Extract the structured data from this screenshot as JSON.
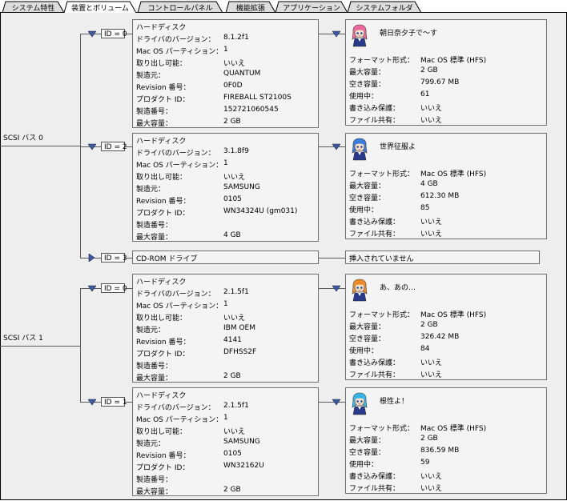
{
  "tabs": [
    {
      "label": "システム特性",
      "active": false
    },
    {
      "label": "装置とボリューム",
      "active": true
    },
    {
      "label": "コントロールパネル",
      "active": false
    },
    {
      "label": "機能拡張",
      "active": false
    },
    {
      "label": "アプリケーション",
      "active": false
    },
    {
      "label": "システムフォルダ",
      "active": false
    }
  ],
  "buses": [
    {
      "label": "SCSI バス 0",
      "devices": [
        {
          "id": "ID = 0",
          "expanded": true,
          "info": {
            "title": "ハードディスク",
            "rows": [
              {
                "k": "ドライバのバージョン：",
                "v": "8.1.2f1"
              },
              {
                "k": "Mac OS パーティション：",
                "v": "1"
              },
              {
                "k": "取り出し可能：",
                "v": "いいえ"
              },
              {
                "k": "製造元：",
                "v": "QUANTUM"
              },
              {
                "k": "Revision 番号：",
                "v": "0F0D"
              },
              {
                "k": "プロダクト ID：",
                "v": "FIREBALL ST2100S"
              },
              {
                "k": "製造番号：",
                "v": "152721060545"
              },
              {
                "k": "最大容量：",
                "v": "2 GB"
              }
            ]
          },
          "volume": {
            "name": "朝日奈夕子で～す",
            "avatar": "pink",
            "rows": [
              {
                "k": "フォーマット形式：",
                "v": "Mac OS 標準 (HFS)"
              },
              {
                "k": "最大容量：",
                "v": "2 GB"
              },
              {
                "k": "空き容量：",
                "v": "799.67 MB"
              },
              {
                "k": "使用中：",
                "v": "61"
              },
              {
                "k": "書き込み保護：",
                "v": "いいえ"
              },
              {
                "k": "ファイル共有：",
                "v": "いいえ"
              }
            ]
          }
        },
        {
          "id": "ID = 2",
          "expanded": true,
          "info": {
            "title": "ハードディスク",
            "rows": [
              {
                "k": "ドライバのバージョン：",
                "v": "3.1.8f9"
              },
              {
                "k": "Mac OS パーティション：",
                "v": "1"
              },
              {
                "k": "取り出し可能：",
                "v": "いいえ"
              },
              {
                "k": "製造元：",
                "v": "SAMSUNG"
              },
              {
                "k": "Revision 番号：",
                "v": "0105"
              },
              {
                "k": "プロダクト ID：",
                "v": "WN34324U (gm031)"
              },
              {
                "k": "製造番号：",
                "v": ""
              },
              {
                "k": "最大容量：",
                "v": "4 GB"
              }
            ]
          },
          "volume": {
            "name": "世界征服よ",
            "avatar": "blue",
            "rows": [
              {
                "k": "フォーマット形式：",
                "v": "Mac OS 標準 (HFS)"
              },
              {
                "k": "最大容量：",
                "v": "4 GB"
              },
              {
                "k": "空き容量：",
                "v": "612.30 MB"
              },
              {
                "k": "使用中：",
                "v": "85"
              },
              {
                "k": "書き込み保護：",
                "v": "いいえ"
              },
              {
                "k": "ファイル共有：",
                "v": "いいえ"
              }
            ]
          }
        },
        {
          "id": "ID = 3",
          "expanded": false,
          "info": {
            "title": "CD-ROM ドライブ",
            "rows": []
          },
          "volume": {
            "empty_text": "挿入されていません"
          }
        }
      ]
    },
    {
      "label": "SCSI バス 1",
      "devices": [
        {
          "id": "ID = 0",
          "expanded": true,
          "info": {
            "title": "ハードディスク",
            "rows": [
              {
                "k": "ドライバのバージョン：",
                "v": "2.1.5f1"
              },
              {
                "k": "Mac OS パーティション：",
                "v": "1"
              },
              {
                "k": "取り出し可能：",
                "v": "いいえ"
              },
              {
                "k": "製造元：",
                "v": "IBM OEM"
              },
              {
                "k": "Revision 番号：",
                "v": "4141"
              },
              {
                "k": "プロダクト ID：",
                "v": "DFHSS2F"
              },
              {
                "k": "製造番号：",
                "v": ""
              },
              {
                "k": "最大容量：",
                "v": "2 GB"
              }
            ]
          },
          "volume": {
            "name": "あ、あの…",
            "avatar": "orange",
            "rows": [
              {
                "k": "フォーマット形式：",
                "v": "Mac OS 標準 (HFS)"
              },
              {
                "k": "最大容量：",
                "v": "2 GB"
              },
              {
                "k": "空き容量：",
                "v": "326.42 MB"
              },
              {
                "k": "使用中：",
                "v": "84"
              },
              {
                "k": "書き込み保護：",
                "v": "いいえ"
              },
              {
                "k": "ファイル共有：",
                "v": "いいえ"
              }
            ]
          }
        },
        {
          "id": "ID = 1",
          "expanded": true,
          "info": {
            "title": "ハードディスク",
            "rows": [
              {
                "k": "ドライバのバージョン：",
                "v": "2.1.5f1"
              },
              {
                "k": "Mac OS パーティション：",
                "v": "1"
              },
              {
                "k": "取り出し可能：",
                "v": "いいえ"
              },
              {
                "k": "製造元：",
                "v": "SAMSUNG"
              },
              {
                "k": "Revision 番号：",
                "v": "0105"
              },
              {
                "k": "プロダクト ID：",
                "v": "WN32162U"
              },
              {
                "k": "製造番号：",
                "v": ""
              },
              {
                "k": "最大容量：",
                "v": "2 GB"
              }
            ]
          },
          "volume": {
            "name": "根性よ！",
            "avatar": "cyan",
            "rows": [
              {
                "k": "フォーマット形式：",
                "v": "Mac OS 標準 (HFS)"
              },
              {
                "k": "最大容量：",
                "v": "2 GB"
              },
              {
                "k": "空き容量：",
                "v": "836.59 MB"
              },
              {
                "k": "使用中：",
                "v": "59"
              },
              {
                "k": "書き込み保護：",
                "v": "いいえ"
              },
              {
                "k": "ファイル共有：",
                "v": "いいえ"
              }
            ]
          }
        }
      ]
    }
  ],
  "colors": {
    "content_bg": "#eeeeee",
    "triangle": "#3c5aa0",
    "tab_active": "#ffffff",
    "tab_inactive": "#dddddd",
    "avatar_pink": "#f06aa0",
    "avatar_blue": "#3d7de0",
    "avatar_orange": "#f08c2a",
    "avatar_cyan": "#38b8e8"
  }
}
